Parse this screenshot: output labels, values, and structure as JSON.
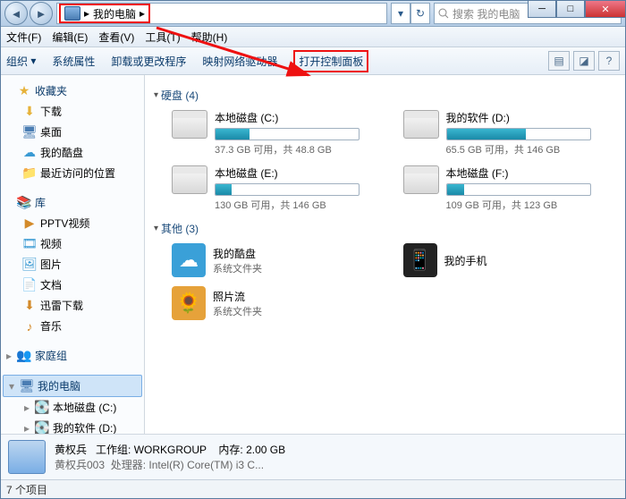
{
  "titlebar": {
    "address_root": "我的电脑",
    "search_placeholder": "搜索 我的电脑"
  },
  "menubar": [
    "文件(F)",
    "编辑(E)",
    "查看(V)",
    "工具(T)",
    "帮助(H)"
  ],
  "toolbar": {
    "organize": "组织",
    "sys_props": "系统属性",
    "uninstall": "卸载或更改程序",
    "map_drive": "映射网络驱动器",
    "control_panel": "打开控制面板"
  },
  "sidebar": {
    "favorites": {
      "label": "收藏夹",
      "items": [
        "下载",
        "桌面",
        "我的酷盘",
        "最近访问的位置"
      ]
    },
    "libraries": {
      "label": "库",
      "items": [
        "PPTV视频",
        "视频",
        "图片",
        "文档",
        "迅雷下载",
        "音乐"
      ]
    },
    "homegroup": {
      "label": "家庭组"
    },
    "computer": {
      "label": "我的电脑",
      "items": [
        "本地磁盘 (C:)",
        "我的软件 (D:)"
      ]
    }
  },
  "content": {
    "group_drives": "硬盘 (4)",
    "group_others": "其他 (3)",
    "drives": [
      {
        "title": "本地磁盘 (C:)",
        "sub": "37.3 GB 可用，共 48.8 GB",
        "pct": 24
      },
      {
        "title": "我的软件 (D:)",
        "sub": "65.5 GB 可用，共 146 GB",
        "pct": 55
      },
      {
        "title": "本地磁盘 (E:)",
        "sub": "130 GB 可用，共 146 GB",
        "pct": 11
      },
      {
        "title": "本地磁盘 (F:)",
        "sub": "109 GB 可用，共 123 GB",
        "pct": 12
      }
    ],
    "others": [
      {
        "title": "我的酷盘",
        "sub": "系统文件夹",
        "color": "#3aa0d8",
        "glyph": "☁"
      },
      {
        "title": "我的手机",
        "sub": "",
        "color": "#222",
        "glyph": "📱"
      },
      {
        "title": "照片流",
        "sub": "系统文件夹",
        "color": "#e6a23a",
        "glyph": "🌻"
      }
    ]
  },
  "details": {
    "name": "黄权兵",
    "name2": "黄权兵003",
    "workgroup_label": "工作组:",
    "workgroup": "WORKGROUP",
    "cpu_label": "处理器:",
    "cpu": "Intel(R) Core(TM) i3 C...",
    "ram_label": "内存:",
    "ram": "2.00 GB"
  },
  "status": "7 个项目"
}
